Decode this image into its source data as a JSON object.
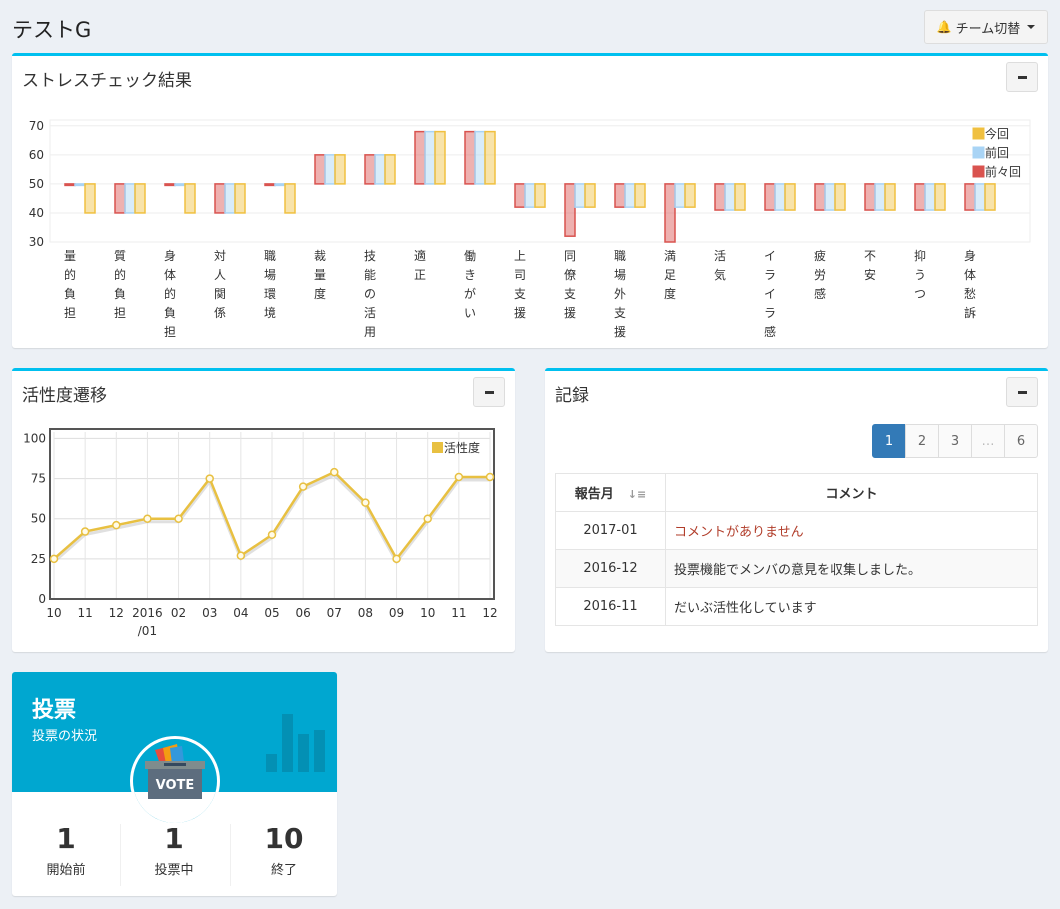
{
  "header": {
    "title": "テストG",
    "team_switch_label": "チーム切替"
  },
  "stress": {
    "title": "ストレスチェック結果",
    "chart_data": {
      "type": "bar",
      "categories": [
        "量的負担",
        "質的負担",
        "身体的負担",
        "対人関係",
        "職場環境",
        "裁量度",
        "技能の活用",
        "適正",
        "働きがい",
        "上司支援",
        "同僚支援",
        "職場外支援",
        "満足度",
        "活気",
        "イライラ感",
        "疲労感",
        "不安",
        "抑うつ",
        "身体愁訴"
      ],
      "series": [
        {
          "name": "前々回",
          "color": "#d9534f",
          "values": [
            50,
            40,
            50,
            40,
            50,
            60,
            60,
            68,
            68,
            42,
            32,
            42,
            30,
            41,
            41,
            41,
            41,
            41,
            41
          ]
        },
        {
          "name": "前回",
          "color": "#a9d4f5",
          "values": [
            50,
            40,
            50,
            40,
            50,
            60,
            60,
            68,
            68,
            42,
            42,
            42,
            42,
            41,
            41,
            41,
            41,
            41,
            41
          ]
        },
        {
          "name": "今回",
          "color": "#f0c040",
          "values": [
            40,
            40,
            40,
            40,
            40,
            60,
            60,
            68,
            68,
            42,
            42,
            42,
            42,
            41,
            41,
            41,
            41,
            41,
            41
          ]
        }
      ],
      "yticks": [
        70,
        60,
        50,
        40,
        30
      ],
      "ylim": [
        30,
        72
      ],
      "baseline": 50,
      "legend": "top-right"
    }
  },
  "activity": {
    "title": "活性度遷移",
    "chart_data": {
      "type": "line",
      "x": [
        "10",
        "11",
        "12",
        "2016/01",
        "02",
        "03",
        "04",
        "05",
        "06",
        "07",
        "08",
        "09",
        "10",
        "11",
        "12"
      ],
      "series": [
        {
          "name": "活性度",
          "color": "#e8c041",
          "values": [
            25,
            42,
            46,
            50,
            50,
            75,
            27,
            40,
            70,
            79,
            60,
            25,
            50,
            76,
            76
          ]
        }
      ],
      "yticks": [
        100,
        75,
        50,
        25,
        0
      ],
      "ylim": [
        0,
        104
      ],
      "grid": true,
      "legend": "top-right"
    }
  },
  "record": {
    "title": "記録",
    "pages": [
      "1",
      "2",
      "3",
      "…",
      "6"
    ],
    "columns": {
      "month": "報告月",
      "comment": "コメント"
    },
    "rows": [
      {
        "month": "2017-01",
        "comment": "コメントがありません"
      },
      {
        "month": "2016-12",
        "comment": "投票機能でメンバの意見を収集しました。"
      },
      {
        "month": "2016-11",
        "comment": "だいぶ活性化しています"
      }
    ]
  },
  "vote": {
    "title": "投票",
    "subtitle": "投票の状況",
    "badge": "VOTE",
    "stats": [
      {
        "num": "1",
        "label": "開始前"
      },
      {
        "num": "1",
        "label": "投票中"
      },
      {
        "num": "10",
        "label": "終了"
      }
    ]
  }
}
